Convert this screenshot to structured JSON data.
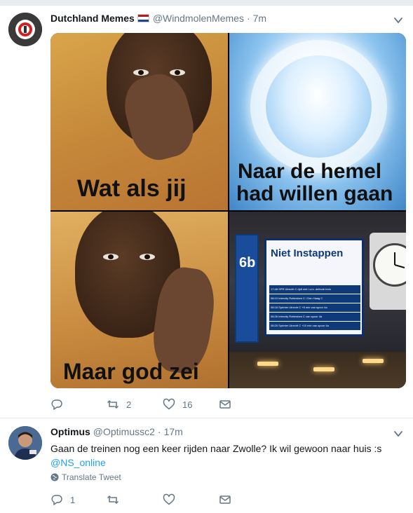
{
  "tweets": [
    {
      "author_name": "Dutchland Memes",
      "handle": "@WindmolenMemes",
      "time": "7m",
      "separator": "·",
      "media": {
        "panel1_text": "Wat als jij",
        "panel2_text_line1": "Naar de hemel",
        "panel2_text_line2": "had willen gaan",
        "panel3_text": "Maar god zei",
        "sign_platform": "6b",
        "sign_title": "Niet Instappen",
        "sign_rows": [
          "17:48 SPR Utrecht C rijdt niet i.v.m. defecte trein",
          "08:10 Intercity Rotterdam C / Den Haag C",
          "08:18 Sprinter Utrecht C +5 min van spoor 4a",
          "08:26 Intercity Rotterdam C van spoor 4a",
          "08:20 Sprinter Utrecht C +10 min van spoor 4a"
        ]
      },
      "actions": {
        "reply_count": "",
        "retweet_count": "2",
        "like_count": "16"
      }
    },
    {
      "author_name": "Optimus",
      "handle": "@Optimussc2",
      "time": "17m",
      "separator": "·",
      "text": "Gaan de treinen nog een keer rijden naar Zwolle? Ik wil gewoon naar huis :s",
      "mention": "@NS_online",
      "translate_label": "Translate Tweet",
      "actions": {
        "reply_count": "1",
        "retweet_count": "",
        "like_count": ""
      }
    }
  ],
  "colors": {
    "accent": "#1da1f2",
    "secondary_text": "#657786",
    "primary_text": "#14171a",
    "flag_red": "#ae1c28",
    "flag_white": "#ffffff",
    "flag_blue": "#21468b"
  }
}
